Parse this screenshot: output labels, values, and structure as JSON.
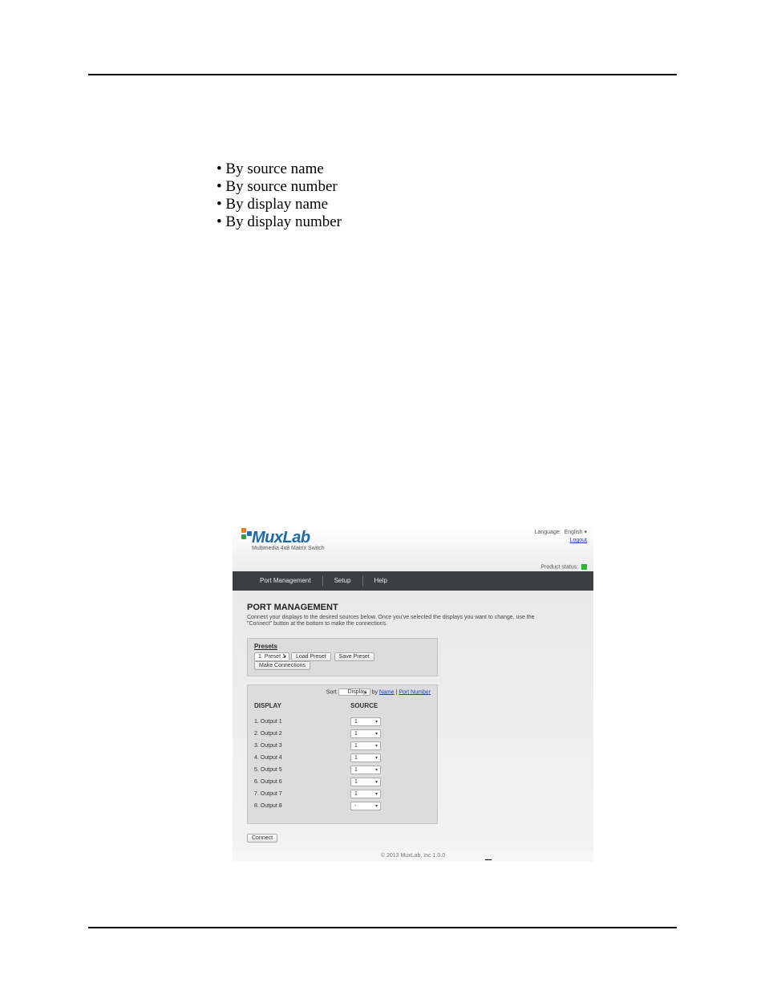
{
  "bullets": {
    "items": [
      "By source name",
      "By source number",
      "By display name",
      "By display number"
    ]
  },
  "app": {
    "header": {
      "language_label": "Language:",
      "language_value": "English",
      "logout_label": "Logout",
      "status_label": "Product status:",
      "logo_text": "MuxLab",
      "logo_sub": "Multimedia 4x8 Matrix Switch"
    },
    "nav": {
      "items": [
        "Port Management",
        "Setup",
        "Help"
      ]
    },
    "portmgmt": {
      "title": "PORT MANAGEMENT",
      "desc": "Connect your displays to the desired sources below. Once you've selected the displays you want to change, use the \"Connect\" button at the bottom to make the connections.",
      "presets_title": "Presets",
      "preset_select": "1. Preset 1",
      "load_preset_btn": "Load Preset",
      "save_preset_btn": "Save Preset",
      "make_conn_btn": "Make Connections",
      "sort_label": "Sort",
      "sort_select": "Display",
      "sort_by": "by",
      "sort_name_link": "Name",
      "sort_port_link": "Port Number",
      "col_display": "DISPLAY",
      "col_source": "SOURCE",
      "rows": [
        {
          "display": "1. Output 1",
          "source": "1"
        },
        {
          "display": "2. Output 2",
          "source": "1"
        },
        {
          "display": "3. Output 3",
          "source": "1"
        },
        {
          "display": "4. Output 4",
          "source": "1"
        },
        {
          "display": "5. Output 5",
          "source": "1"
        },
        {
          "display": "6. Output 6",
          "source": "1"
        },
        {
          "display": "7. Output 7",
          "source": "1"
        },
        {
          "display": "8. Output 8",
          "source": "-"
        }
      ],
      "connect_btn": "Connect"
    },
    "footer": "© 2013 MuxLab, Inc 1.0.0"
  },
  "figure_dash": "–"
}
